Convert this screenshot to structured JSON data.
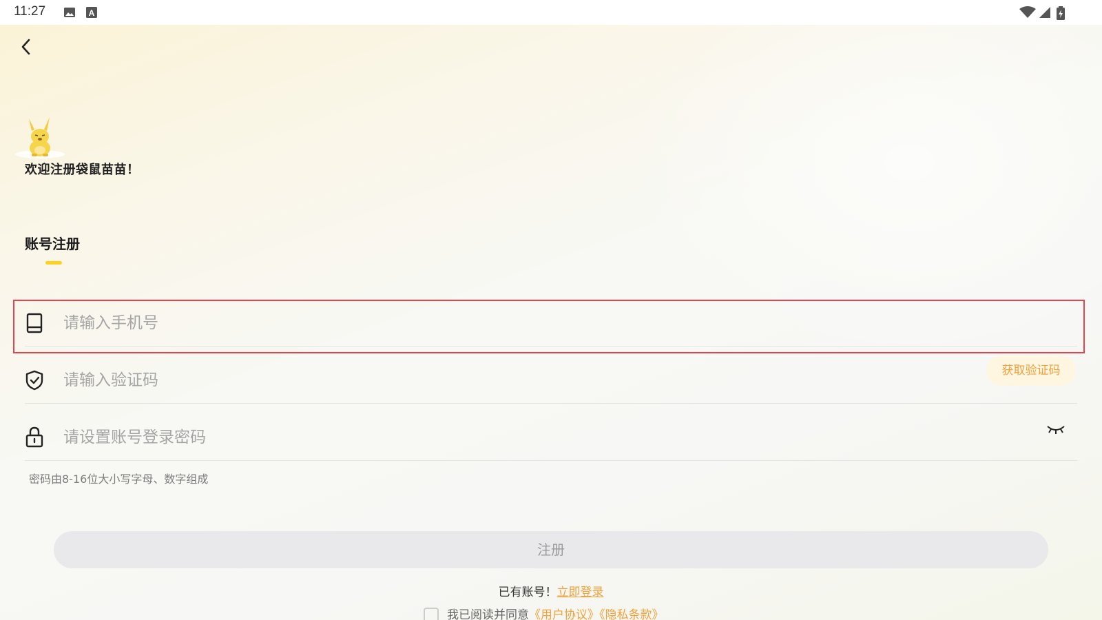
{
  "status_bar": {
    "time": "11:27",
    "left_icons": [
      "image-icon",
      "text-a-icon"
    ],
    "right_icons": [
      "wifi-icon",
      "signal-icon",
      "battery-icon"
    ]
  },
  "header": {
    "back_icon": "chevron-left-icon"
  },
  "welcome": {
    "mascot": "kangaroo-mascot",
    "text": "欢迎注册袋鼠苗苗！"
  },
  "tabs": [
    {
      "label": "账号注册",
      "active": true
    }
  ],
  "form": {
    "phone": {
      "placeholder": "请输入手机号",
      "value": "",
      "icon": "phone-icon"
    },
    "code": {
      "placeholder": "请输入验证码",
      "value": "",
      "icon": "shield-check-icon",
      "button_label": "获取验证码"
    },
    "password": {
      "placeholder": "请设置账号登录密码",
      "value": "",
      "icon": "lock-icon",
      "toggle_icon": "eye-closed-icon"
    },
    "password_hint": "密码由8-16位大小写字母、数字组成"
  },
  "register_button": "注册",
  "login_prompt": {
    "text": "已有账号！",
    "link": "立即登录"
  },
  "agreement": {
    "text": "我已阅读并同意",
    "user_agreement": "《用户协议》",
    "privacy": "《隐私条款》",
    "checked": false
  },
  "colors": {
    "accent": "#f2a23b",
    "tab_indicator": "#ffd21f",
    "highlight": "#e8424d"
  }
}
